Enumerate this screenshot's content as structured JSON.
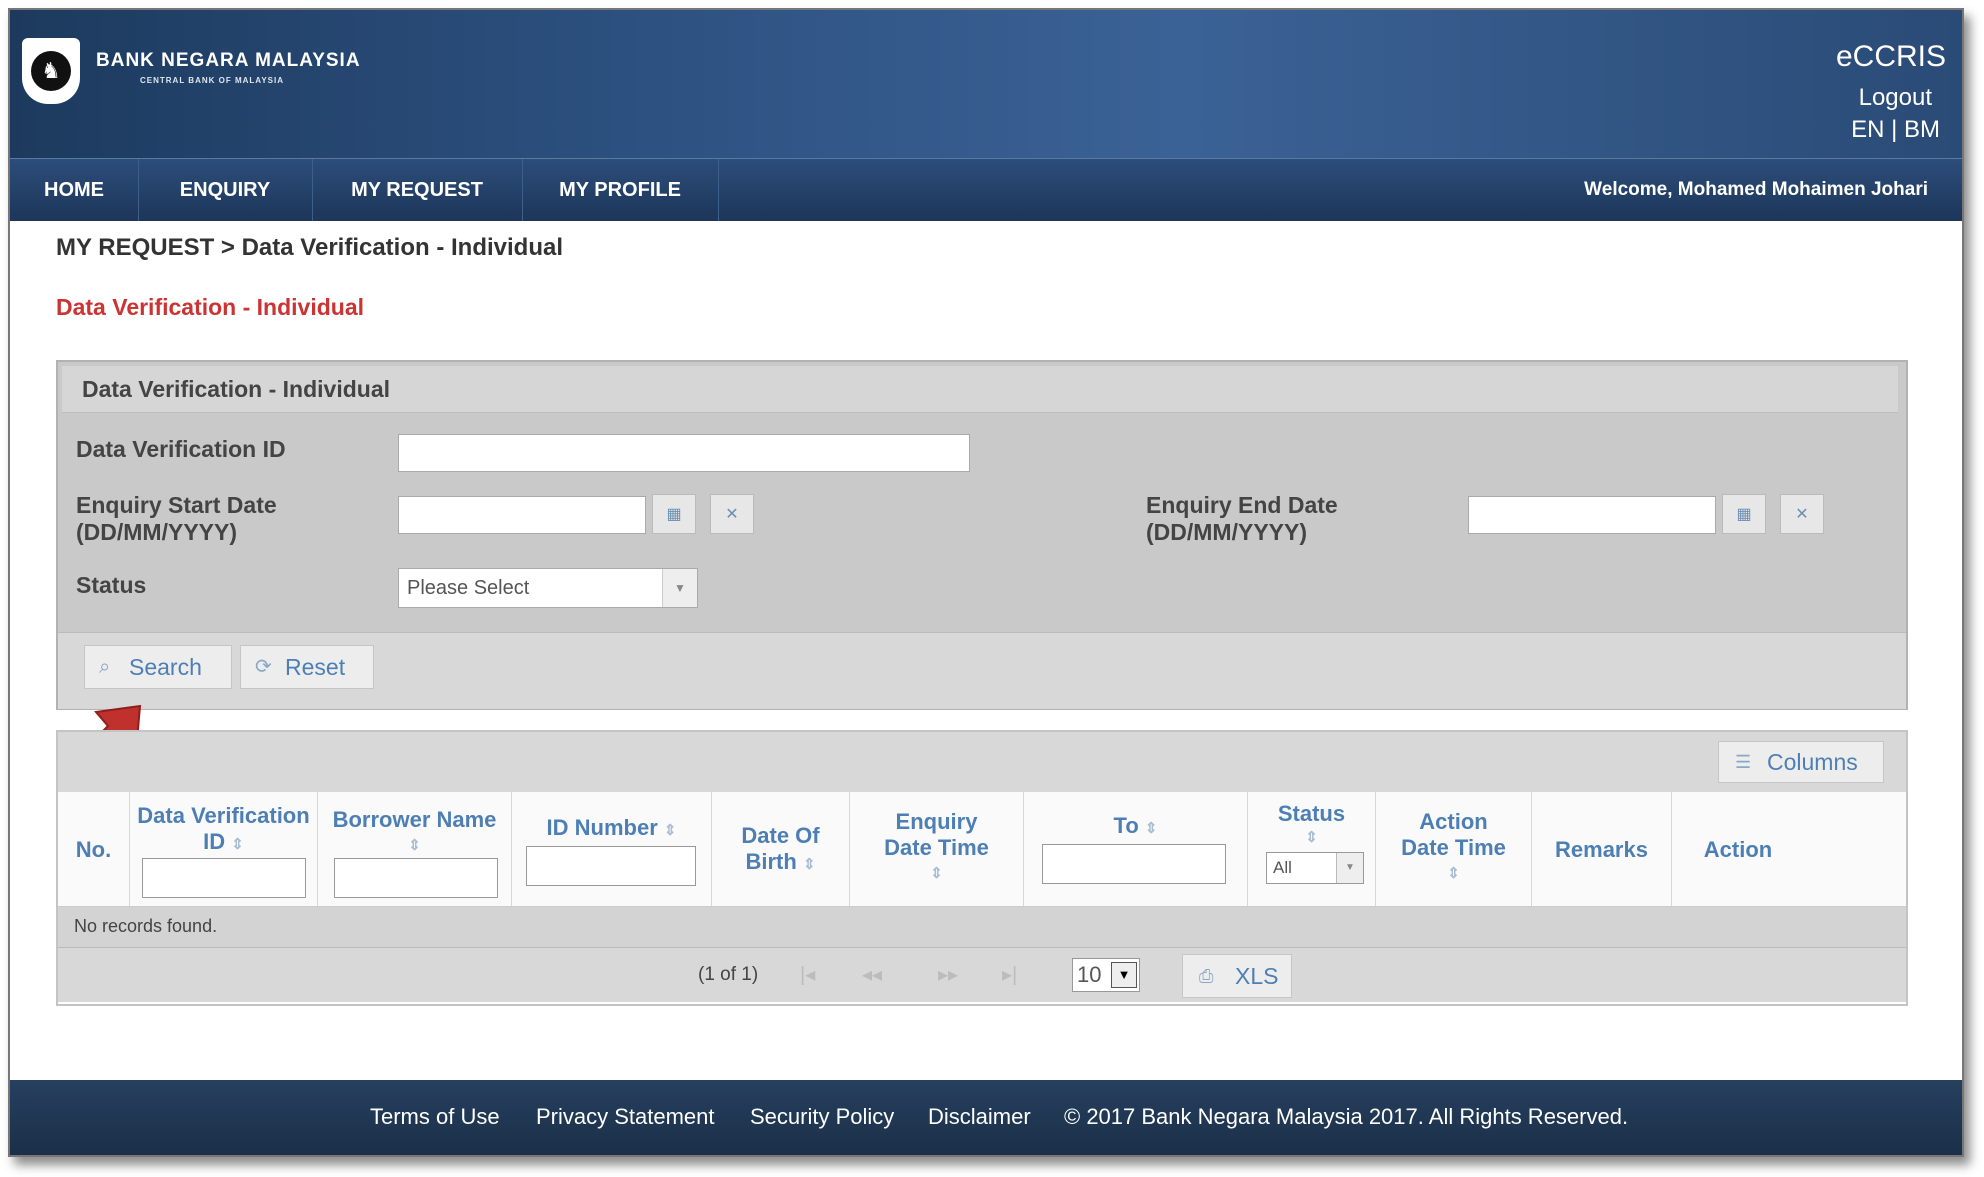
{
  "header": {
    "bank_name": "BANK NEGARA MALAYSIA",
    "bank_sub": "CENTRAL BANK OF MALAYSIA",
    "app_name": "eCCRIS",
    "logout": "Logout",
    "lang": "EN | BM"
  },
  "nav": {
    "items": [
      "HOME",
      "ENQUIRY",
      "MY REQUEST",
      "MY PROFILE"
    ],
    "welcome": "Welcome, Mohamed Mohaimen Johari"
  },
  "breadcrumb": "MY REQUEST > Data Verification - Individual",
  "page_title": "Data Verification - Individual",
  "search_panel": {
    "title": "Data Verification - Individual",
    "dv_id_label": "Data Verification ID",
    "start_date_label_1": "Enquiry Start Date",
    "start_date_label_2": "(DD/MM/YYYY)",
    "end_date_label_1": "Enquiry End Date",
    "end_date_label_2": "(DD/MM/YYYY)",
    "status_label": "Status",
    "status_value": "Please Select",
    "search_button": "Search",
    "reset_button": "Reset"
  },
  "table": {
    "columns_button": "Columns",
    "headers": {
      "no": "No.",
      "dv_id_1": "Data Verification",
      "dv_id_2": "ID",
      "borrower": "Borrower Name",
      "id_number": "ID Number",
      "dob_1": "Date Of",
      "dob_2": "Birth",
      "enq_1": "Enquiry",
      "enq_2": "Date Time",
      "to": "To",
      "status": "Status",
      "act_1": "Action",
      "act_2": "Date Time",
      "remarks": "Remarks",
      "action": "Action"
    },
    "status_filter": "All",
    "empty_message": "No records found.",
    "pager_count": "(1 of 1)",
    "page_size": "10",
    "xls_button": "XLS"
  },
  "footer": {
    "links": [
      "Terms of Use",
      "Privacy Statement",
      "Security Policy",
      "Disclaimer"
    ],
    "copyright": "© 2017 Bank Negara Malaysia 2017. All Rights Reserved."
  },
  "colors": {
    "header_blue": "#2e5383",
    "title_red": "#cc3333",
    "link_blue": "#4d7fb4",
    "arrow_red": "#c0302c"
  },
  "icons": [
    "bnm-logo-icon",
    "calendar-icon",
    "clear-icon",
    "search-icon",
    "reset-icon",
    "columns-icon",
    "xls-icon",
    "pointer-arrow-icon"
  ]
}
